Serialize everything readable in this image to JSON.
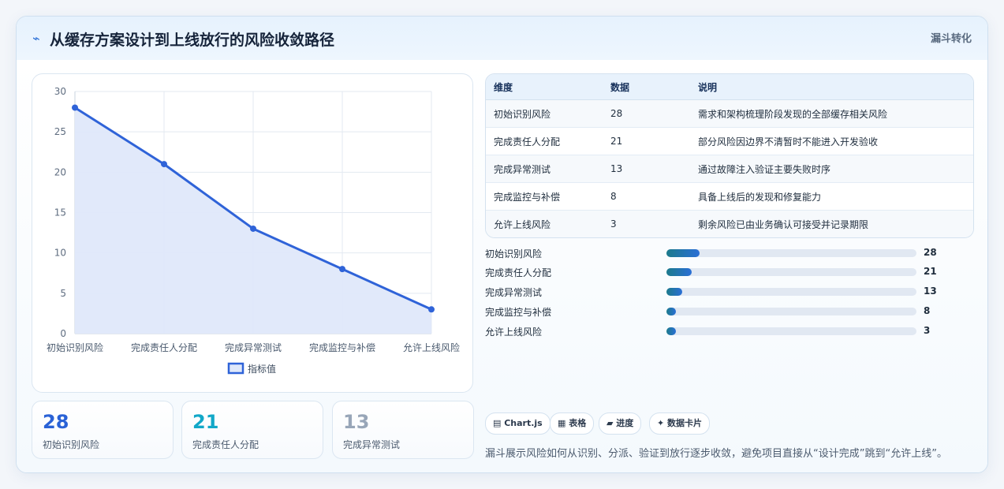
{
  "header": {
    "icon": "lightning-icon",
    "icon_glyph": "⌁",
    "title": "从缓存方案设计到上线放行的风险收敛路径",
    "badge": "漏斗转化"
  },
  "chart_data": {
    "type": "line",
    "categories": [
      "初始识别风险",
      "完成责任人分配",
      "完成异常测试",
      "完成监控与补偿",
      "允许上线风险"
    ],
    "series": [
      {
        "name": "指标值",
        "values": [
          28,
          21,
          13,
          8,
          3
        ]
      }
    ],
    "ylim": [
      0,
      30
    ],
    "yticks": [
      0,
      5,
      10,
      15,
      20,
      25,
      30
    ],
    "grid": true,
    "area_fill": true,
    "legend": "bottom",
    "colors": {
      "line": "#2f63d8",
      "fill": "#dfe8fa",
      "grid": "#e3e9f1"
    }
  },
  "kpis": [
    {
      "value": "28",
      "label": "初始识别风险",
      "color": "#2a62d6"
    },
    {
      "value": "21",
      "label": "完成责任人分配",
      "color": "#12a8c8"
    },
    {
      "value": "13",
      "label": "完成异常测试",
      "color": "#98a6b8"
    }
  ],
  "table": {
    "headers": [
      "维度",
      "数据",
      "说明"
    ],
    "rows": [
      [
        "初始识别风险",
        "28",
        "需求和架构梳理阶段发现的全部缓存相关风险"
      ],
      [
        "完成责任人分配",
        "21",
        "部分风险因边界不清暂时不能进入开发验收"
      ],
      [
        "完成异常测试",
        "13",
        "通过故障注入验证主要失败时序"
      ],
      [
        "完成监控与补偿",
        "8",
        "具备上线后的发现和修复能力"
      ],
      [
        "允许上线风险",
        "3",
        "剩余风险已由业务确认可接受并记录期限"
      ]
    ]
  },
  "progress": {
    "max": 28,
    "items": [
      {
        "label": "初始识别风险",
        "value": 28
      },
      {
        "label": "完成责任人分配",
        "value": 21
      },
      {
        "label": "完成异常测试",
        "value": 13
      },
      {
        "label": "完成监控与补偿",
        "value": 8
      },
      {
        "label": "允许上线风险",
        "value": 3
      }
    ]
  },
  "chips": [
    "▤ Chart.js",
    "▦ 表格",
    "▰ 进度",
    "✦ 数据卡片"
  ],
  "note": "漏斗展示风险如何从识别、分派、验证到放行逐步收敛，避免项目直接从“设计完成”跳到“允许上线”。"
}
